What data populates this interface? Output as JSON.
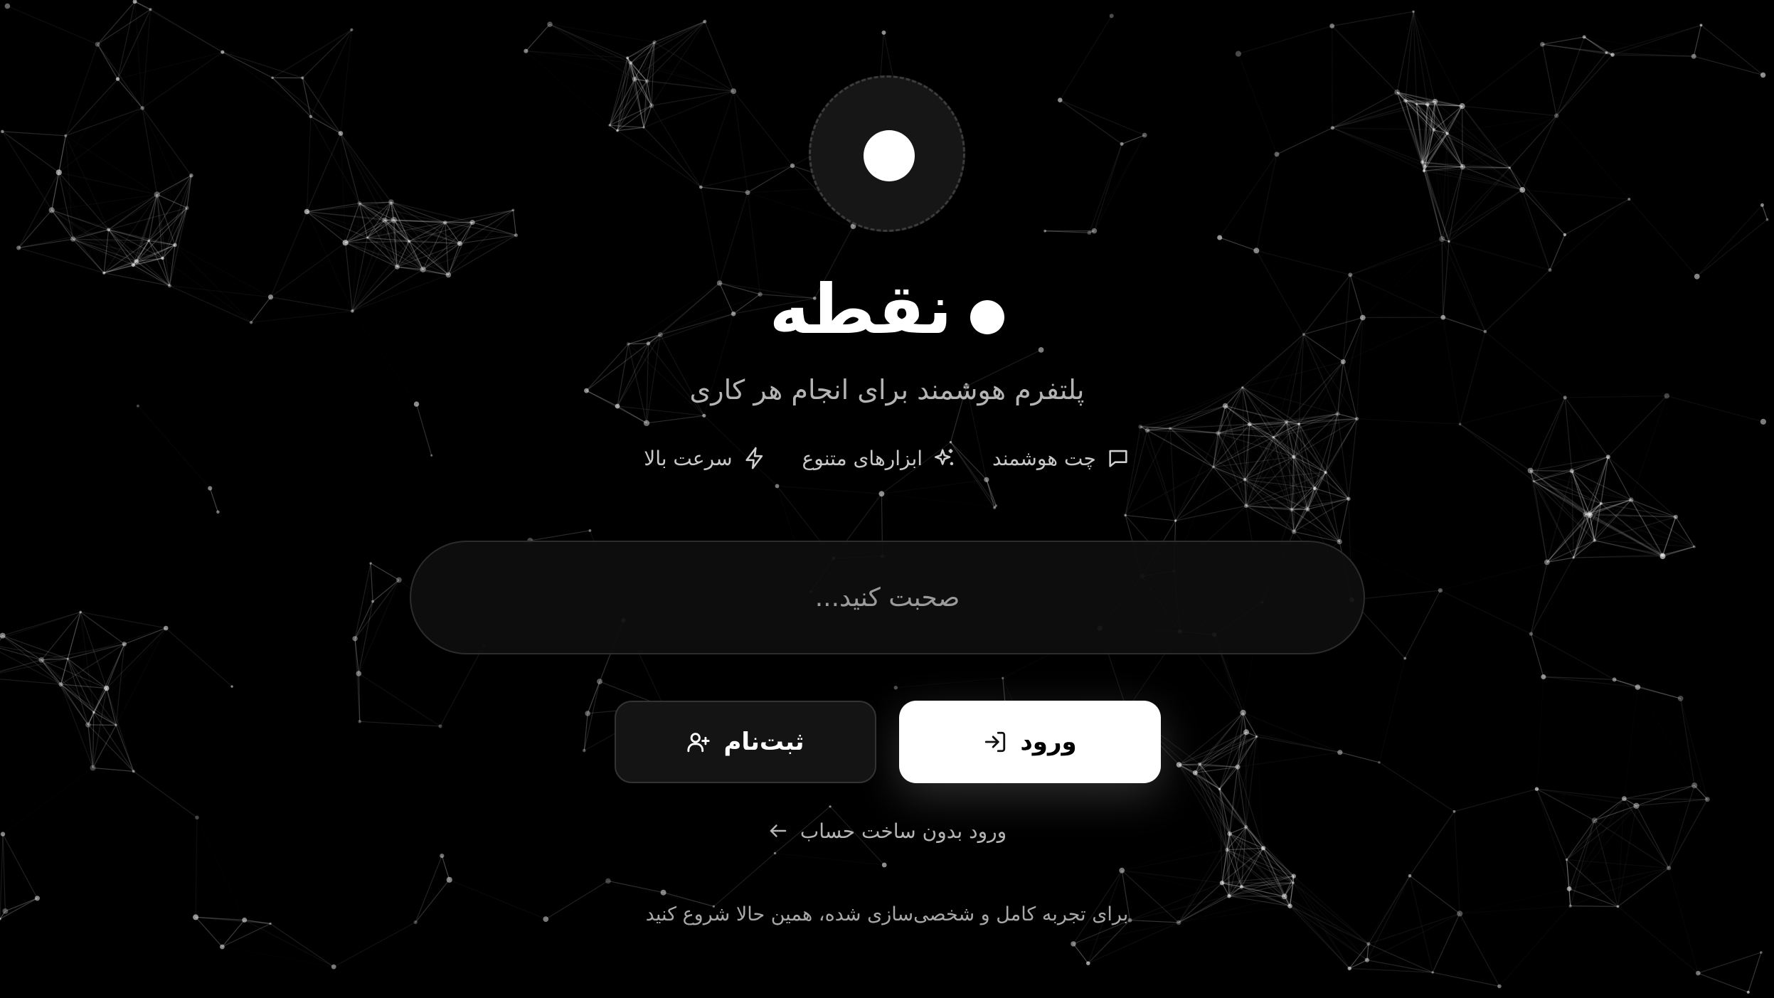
{
  "brand": {
    "name": "نقطه"
  },
  "tagline": "پلتفرم هوشمند برای انجام هر کاری",
  "features": [
    {
      "label": "چت هوشمند",
      "icon": "chat-bubble-icon"
    },
    {
      "label": "ابزارهای متنوع",
      "icon": "sparkles-icon"
    },
    {
      "label": "سرعت بالا",
      "icon": "lightning-icon"
    }
  ],
  "chat": {
    "placeholder": "صحبت کنید...",
    "value": ""
  },
  "actions": {
    "login_label": "ورود",
    "login_icon": "login-icon",
    "signup_label": "ثبت‌نام",
    "signup_icon": "user-plus-icon"
  },
  "guest": {
    "label": "ورود بدون ساخت حساب",
    "icon": "arrow-left-icon"
  },
  "footer": {
    "note": "برای تجربه کامل و شخصی‌سازی شده، همین حالا شروع کنید"
  },
  "colors": {
    "background": "#000000",
    "primary_button": "#ffffff",
    "secondary_button": "#141414",
    "muted_text": "#b4b4b4"
  }
}
